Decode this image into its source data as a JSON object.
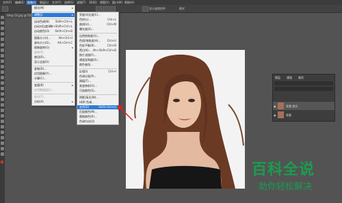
{
  "menubar": {
    "items": [
      "文件(F)",
      "编辑(E)",
      "图像(I)",
      "图层(L)",
      "文字(Y)",
      "选择(S)",
      "滤镜(T)",
      "3D(D)",
      "视图(V)",
      "窗口(W)",
      "帮助(H)"
    ],
    "active_index": 2
  },
  "options_bar": {
    "label": "模式",
    "checkbox_label": "显示变换控件"
  },
  "document_tab": {
    "title": "timg (3).jpg @ 50..."
  },
  "image_menu": {
    "items": [
      {
        "label": "模式(M)",
        "shortcut": "",
        "submenu": true
      },
      {
        "label": "调整(J)",
        "shortcut": "",
        "submenu": true,
        "highlight": true
      },
      {
        "label": "自动色调(N)",
        "shortcut": "Shift+Ctrl+L"
      },
      {
        "label": "自动对比度(U)",
        "shortcut": "Alt+Shift+Ctrl+L"
      },
      {
        "label": "自动颜色(O)",
        "shortcut": "Shift+Ctrl+B"
      },
      {
        "label": "图像大小(I)...",
        "shortcut": "Alt+Ctrl+I"
      },
      {
        "label": "画布大小(S)...",
        "shortcut": "Alt+Ctrl+C"
      },
      {
        "label": "图像旋转(G)",
        "shortcut": "",
        "submenu": true
      },
      {
        "label": "裁剪(P)",
        "shortcut": ""
      },
      {
        "label": "裁切(R)...",
        "shortcut": ""
      },
      {
        "label": "显示全部(V)",
        "shortcut": ""
      },
      {
        "label": "复制(D)...",
        "shortcut": ""
      },
      {
        "label": "应用图像(Y)...",
        "shortcut": ""
      },
      {
        "label": "计算(C)...",
        "shortcut": ""
      },
      {
        "label": "变量(B)",
        "shortcut": "",
        "submenu": true
      },
      {
        "label": "应用数据组(L)...",
        "shortcut": ""
      },
      {
        "label": "陷印(T)...",
        "shortcut": ""
      },
      {
        "label": "分析(A)",
        "shortcut": "",
        "submenu": true
      }
    ]
  },
  "adjust_menu": {
    "items": [
      {
        "label": "亮度/对比度(C)...",
        "shortcut": ""
      },
      {
        "label": "色阶(L)...",
        "shortcut": "Ctrl+L"
      },
      {
        "label": "曲线(U)...",
        "shortcut": "Ctrl+M"
      },
      {
        "label": "曝光度(E)...",
        "shortcut": ""
      },
      {
        "label": "自然饱和度(V)...",
        "shortcut": ""
      },
      {
        "label": "色相/饱和度(H)...",
        "shortcut": "Ctrl+U"
      },
      {
        "label": "色彩平衡(B)...",
        "shortcut": "Ctrl+B"
      },
      {
        "label": "黑白(K)...",
        "shortcut": "Alt+Shift+Ctrl+B"
      },
      {
        "label": "照片滤镜(F)...",
        "shortcut": ""
      },
      {
        "label": "通道混和器(X)...",
        "shortcut": ""
      },
      {
        "label": "颜色查找...",
        "shortcut": ""
      },
      {
        "label": "反相(I)",
        "shortcut": "Ctrl+I"
      },
      {
        "label": "色调分离(P)...",
        "shortcut": ""
      },
      {
        "label": "阈值(T)...",
        "shortcut": ""
      },
      {
        "label": "渐变映射(G)...",
        "shortcut": ""
      },
      {
        "label": "可选颜色(S)...",
        "shortcut": ""
      },
      {
        "label": "阴影/高光(W)...",
        "shortcut": ""
      },
      {
        "label": "HDR 色调...",
        "shortcut": ""
      },
      {
        "label": "去色(D)",
        "shortcut": "Shift+Ctrl+U",
        "highlight": true
      },
      {
        "label": "匹配颜色(M)...",
        "shortcut": ""
      },
      {
        "label": "替换颜色(R)...",
        "shortcut": ""
      },
      {
        "label": "色调均化(Q)",
        "shortcut": ""
      }
    ]
  },
  "layers_panel": {
    "tabs": [
      "图层",
      "通道",
      "路径"
    ],
    "layers": [
      {
        "name": "背景 拷贝",
        "selected": true
      },
      {
        "name": "背景",
        "selected": false
      }
    ]
  },
  "watermark": {
    "title": "百科全说",
    "subtitle": "助你轻松解决"
  },
  "colors": {
    "highlight": "#2d7bd6",
    "annotation_arrow": "#e02020",
    "watermark": "#1a9d4e"
  }
}
